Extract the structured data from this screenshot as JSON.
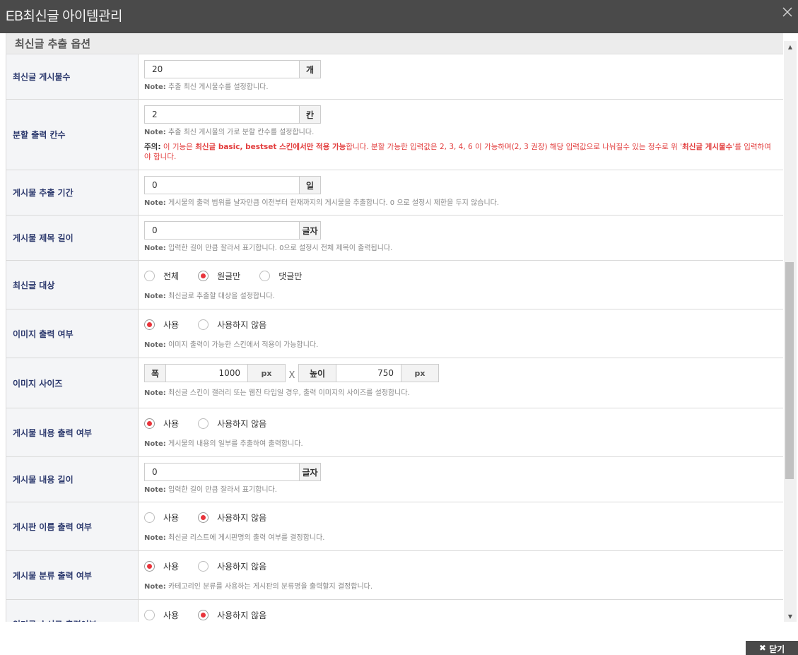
{
  "window": {
    "title": "EB최신글 아이템관리"
  },
  "section": {
    "title": "최신글 추출 옵션"
  },
  "note_prefix": "Note:",
  "fields": {
    "post_count": {
      "label": "최신글 게시물수",
      "value": "20",
      "unit": "개",
      "note": "추출 최신 게시물수를 설정합니다."
    },
    "columns": {
      "label": "분할 출력 칸수",
      "value": "2",
      "unit": "칸",
      "note": "추출 최신 게시물의 가로 분할 칸수를 설정합니다.",
      "warn_label": "주의:",
      "warn_pre": " 이 기능은 ",
      "warn_bold1": "최신글 basic, bestset 스킨에서만 적용 가능",
      "warn_mid": "합니다. 분할 가능한 입력값은 2, 3, 4, 6 이 가능하며(2, 3 권장) 해당 입력값으로 나눠질수 있는 정수로 위 '",
      "warn_bold2": "최신글 게시물수",
      "warn_post": "'를 입력하여야 합니다."
    },
    "period": {
      "label": "게시물 추출 기간",
      "value": "0",
      "unit": "일",
      "note": "게시물의 출력 범위를 날자만큼 이전부터 현재까지의 게시물을 추출합니다. 0 으로 설정시 제한을 두지 않습니다."
    },
    "subject_len": {
      "label": "게시물 제목 길이",
      "value": "0",
      "unit": "글자",
      "note": "입력한 길이 만큼 잘라서 표기합니다. 0으로 설정시 전체 제목이 출력됩니다."
    },
    "target": {
      "label": "최신글 대상",
      "options": [
        "전체",
        "원글만",
        "댓글만"
      ],
      "selected": 1,
      "note": "최신글로 추출할 대상을 설정합니다."
    },
    "image_use": {
      "label": "이미지 출력 여부",
      "options": [
        "사용",
        "사용하지 않음"
      ],
      "selected": 0,
      "note": "이미지 출력이 가능한 스킨에서 적용이 가능합니다."
    },
    "image_size": {
      "label": "이미지 사이즈",
      "width_label": "폭",
      "width_value": "1000",
      "height_label": "높이",
      "height_value": "750",
      "unit": "px",
      "times": "X",
      "note": "최신글 스킨이 갤러리 또는 웹진 타입일 경우, 출력 이미지의 사이즈를 설정합니다."
    },
    "content_use": {
      "label": "게시물 내용 출력 여부",
      "options": [
        "사용",
        "사용하지 않음"
      ],
      "selected": 0,
      "note": "게시물의 내용의 일부를 추출하여 출력합니다."
    },
    "content_len": {
      "label": "게시물 내용 길이",
      "value": "0",
      "unit": "글자",
      "note": "입력한 길이 만큼 잘라서 표기합니다."
    },
    "board_name": {
      "label": "게시판 이름 출력 여부",
      "options": [
        "사용",
        "사용하지 않음"
      ],
      "selected": 1,
      "note": "최신글 리스트에 게시판명의 출력 여부를 결정합니다."
    },
    "category": {
      "label": "게시물 분류 출력 여부",
      "options": [
        "사용",
        "사용하지 않음"
      ],
      "selected": 0,
      "note": "카테고리인 분류를 사용하는 게시판의 분류명을 출력할지 결정합니다."
    },
    "popular": {
      "label": "인기글 순서로 출력여부",
      "options": [
        "사용",
        "사용하지 않음"
      ],
      "selected": 1
    }
  },
  "footer": {
    "close_label": "닫기"
  }
}
